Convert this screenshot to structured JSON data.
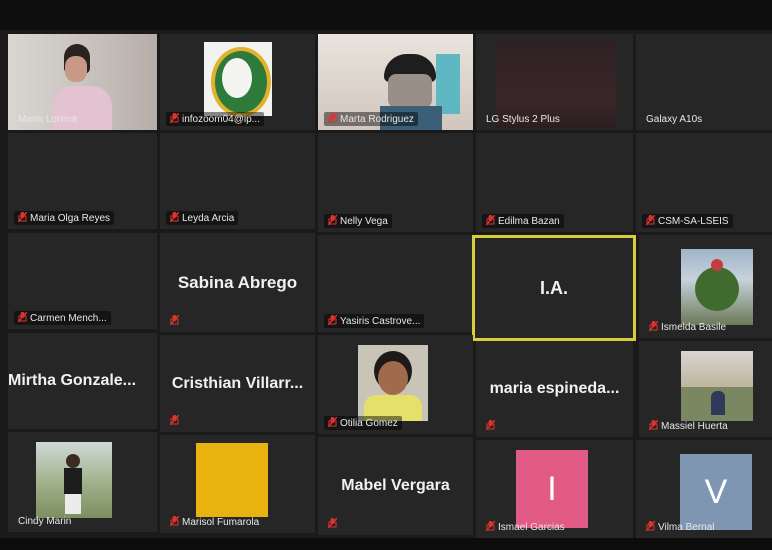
{
  "participants": {
    "maria_lorena": {
      "name": "Maria Lorena"
    },
    "infozoom": {
      "name": "infozoom04@ip..."
    },
    "marta": {
      "name": "Marta Rodriguez"
    },
    "lg_stylus": {
      "name": "LG Stylus 2 Plus"
    },
    "galaxy": {
      "name": "Galaxy A10s"
    },
    "maria_olga": {
      "name": "Maria Olga Reyes"
    },
    "leyda": {
      "name": "Leyda Arcia"
    },
    "nelly": {
      "name": "Nelly Vega"
    },
    "edilma": {
      "name": "Edilma Bazan"
    },
    "csm": {
      "name": "CSM-SA-LSEIS"
    },
    "carmen": {
      "name": "Carmen Mench..."
    },
    "sabina": {
      "display": "Sabina Abrego"
    },
    "yasiris": {
      "name": "Yasiris Castrove..."
    },
    "ia": {
      "display": "I.A."
    },
    "ismelda": {
      "name": "Ismelda Basile"
    },
    "mirtha": {
      "display": "Mirtha Gonzale..."
    },
    "cristhian": {
      "display": "Cristhian Villarr..."
    },
    "otilia": {
      "name": "Otilia Gomez"
    },
    "maria_esp": {
      "display": "maria espineda..."
    },
    "massiel": {
      "name": "Massiel Huerta"
    },
    "cindy": {
      "name": "Cindy Marin"
    },
    "marisol": {
      "name": "Marisol Fumarola"
    },
    "mabel": {
      "display": "Mabel Vergara"
    },
    "ismael": {
      "name": "Ismael Garcias",
      "initial": "I"
    },
    "vilma": {
      "name": "Vilma Bernal",
      "initial": "V"
    }
  },
  "colors": {
    "muted_mic": "#e0322c",
    "active_speaker_border": "#d6cf3a",
    "tile_bg": "#262626",
    "marisol_avatar": "#e9b20f",
    "ismael_avatar": "#e25b86",
    "vilma_avatar": "#7f96b3"
  },
  "icons": {
    "muted": "muted-mic-icon"
  }
}
